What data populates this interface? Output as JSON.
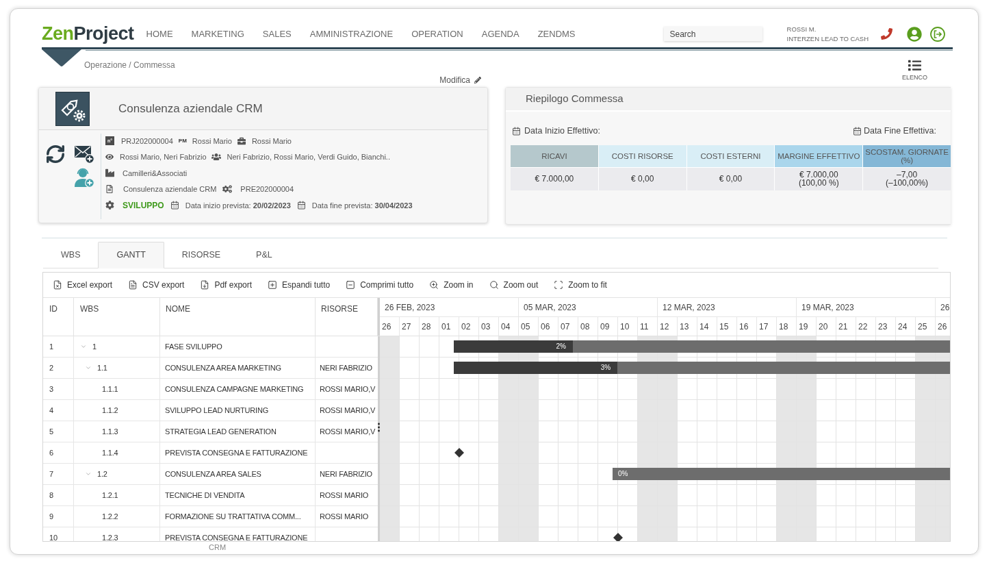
{
  "header": {
    "logo": {
      "part_1": "Zen",
      "part_2": "Project"
    },
    "nav": [
      "HOME",
      "MARKETING",
      "SALES",
      "AMMINISTRAZIONE",
      "OPERATION",
      "AGENDA",
      "ZENDMS"
    ],
    "search": {
      "placeholder": "Search"
    },
    "user": {
      "name": "ROSSI M.",
      "company": "INTERZEN LEAD TO CASH"
    }
  },
  "breadcrumb": "Operazione / Commessa",
  "list_button": {
    "label": "ELENCO"
  },
  "edit_link": {
    "label": "Modifica"
  },
  "project": {
    "title": "Consulenza aziendale CRM",
    "number_label": "n°",
    "code": "PRJ202000004",
    "pm_label": "PM",
    "manager": "Rossi Mario",
    "owner": "Rossi Mario",
    "watchers": "Rossi Mario, Neri Fabrizio",
    "team": "Neri Fabrizio, Rossi Mario, Verdi Guido, Bianchi..",
    "client": "Camilleri&Associati",
    "offer": "Consulenza aziendale CRM",
    "offer_code": "PRE202000004",
    "status": "SVILUPPO",
    "planned_start": "Data inizio prevista: **20/02/2023**",
    "planned_end": "Data fine prevista: **30/04/2023**"
  },
  "summary": {
    "title": "Riepilogo Commessa",
    "start_label": "Data Inizio Effettivo:",
    "end_label": "Data Fine Effettiva:",
    "columns": [
      {
        "header": "RICAVI",
        "color": "#b5c8cc",
        "lines": [
          "€ 7.000,00"
        ]
      },
      {
        "header": "COSTI RISORSE",
        "color": "#d9eef6",
        "lines": [
          "€ 0,00"
        ]
      },
      {
        "header": "COSTI ESTERNI",
        "color": "#d9eef6",
        "lines": [
          "€ 0,00"
        ]
      },
      {
        "header": "MARGINE EFFETTIVO",
        "color": "#aad6ec",
        "lines": [
          "€ 7.000,00",
          "(100,00 %)"
        ]
      },
      {
        "header": "SCOSTAM. GIORNATE (%)",
        "color": "#84b7d6",
        "lines": [
          "–7,00",
          "(–100,00%)"
        ]
      }
    ]
  },
  "tabs": [
    {
      "label": "WBS",
      "selected": false
    },
    {
      "label": "GANTT",
      "selected": true
    },
    {
      "label": "RISORSE",
      "selected": false
    },
    {
      "label": "P&L",
      "selected": false
    }
  ],
  "toolbar": [
    {
      "label": "Excel export",
      "kind": "excel"
    },
    {
      "label": "CSV export",
      "kind": "csv"
    },
    {
      "label": "Pdf export",
      "kind": "pdf"
    },
    {
      "label": "Espandi tutto",
      "kind": "expand"
    },
    {
      "label": "Comprimi tutto",
      "kind": "collapse"
    },
    {
      "label": "Zoom in",
      "kind": "zoom_in"
    },
    {
      "label": "Zoom out",
      "kind": "zoom_out"
    },
    {
      "label": "Zoom to fit",
      "kind": "fit"
    }
  ],
  "gantt": {
    "columns": [
      "ID",
      "WBS",
      "NOME",
      "RISORSE"
    ],
    "weeks": [
      "26 FEB, 2023",
      "05 MAR, 2023",
      "12 MAR, 2023",
      "19 MAR, 2023",
      "26"
    ],
    "days": [
      {
        "label": "26",
        "weekend": true
      },
      {
        "label": "27",
        "weekend": false
      },
      {
        "label": "28",
        "weekend": false
      },
      {
        "label": "01",
        "weekend": false
      },
      {
        "label": "02",
        "weekend": false
      },
      {
        "label": "03",
        "weekend": false
      },
      {
        "label": "04",
        "weekend": true
      },
      {
        "label": "05",
        "weekend": true
      },
      {
        "label": "06",
        "weekend": false
      },
      {
        "label": "07",
        "weekend": false
      },
      {
        "label": "08",
        "weekend": false
      },
      {
        "label": "09",
        "weekend": false
      },
      {
        "label": "10",
        "weekend": false
      },
      {
        "label": "11",
        "weekend": true
      },
      {
        "label": "12",
        "weekend": true
      },
      {
        "label": "13",
        "weekend": false
      },
      {
        "label": "14",
        "weekend": false
      },
      {
        "label": "15",
        "weekend": false
      },
      {
        "label": "16",
        "weekend": false
      },
      {
        "label": "17",
        "weekend": false
      },
      {
        "label": "18",
        "weekend": true
      },
      {
        "label": "19",
        "weekend": true
      },
      {
        "label": "20",
        "weekend": false
      },
      {
        "label": "21",
        "weekend": false
      },
      {
        "label": "22",
        "weekend": false
      },
      {
        "label": "23",
        "weekend": false
      },
      {
        "label": "24",
        "weekend": false
      },
      {
        "label": "25",
        "weekend": true
      },
      {
        "label": "26",
        "weekend": true
      }
    ],
    "rows": [
      {
        "id": "1",
        "wbs": "1",
        "name": "FASE SVILUPPO",
        "expanded": true,
        "bar": {
          "kind": "task",
          "label": "2%",
          "level": 0.24
        },
        "children": [
          {
            "id": "2",
            "wbs": "1.1",
            "name": "CONSULENZA AREA MARKETING",
            "resources": "NERI FABRIZIO",
            "expanded": true,
            "bar": {
              "kind": "task",
              "label": "3%",
              "level": 0.33
            },
            "children": [
              {
                "id": "3",
                "wbs": "1.1.1",
                "name": "CONSULENZA CAMPAGNE MARKETING",
                "resources": "ROSSI MARIO,V"
              },
              {
                "id": "4",
                "wbs": "1.1.2",
                "name": "SVILUPPO LEAD NURTURING",
                "resources": "ROSSI MARIO,V"
              },
              {
                "id": "5",
                "wbs": "1.1.3",
                "name": "STRATEGIA LEAD GENERATION",
                "resources": "ROSSI MARIO,V"
              },
              {
                "id": "6",
                "wbs": "1.1.4",
                "name": "PREVISTA CONSEGNA E FATTURAZIONE",
                "bar": {
                  "kind": "milestone"
                }
              }
            ]
          },
          {
            "id": "7",
            "wbs": "1.2",
            "name": "CONSULENZA AREA SALES",
            "resources": "NERI FABRIZIO",
            "expanded": true,
            "bar": {
              "kind": "task",
              "label": "0%"
            },
            "children": [
              {
                "id": "8",
                "wbs": "1.2.1",
                "name": "TECNICHE DI VENDITA",
                "resources": "ROSSI MARIO"
              },
              {
                "id": "9",
                "wbs": "1.2.2",
                "name": "FORMAZIONE SU TRATTATIVA COMM...",
                "resources": "ROSSI MARIO"
              },
              {
                "id": "10",
                "wbs": "1.2.3",
                "name": "PREVISTA CONSEGNA E FATTURAZIONE",
                "bar": {
                  "kind": "milestone"
                }
              }
            ]
          }
        ]
      }
    ]
  },
  "footer": {
    "text": "CRM"
  }
}
